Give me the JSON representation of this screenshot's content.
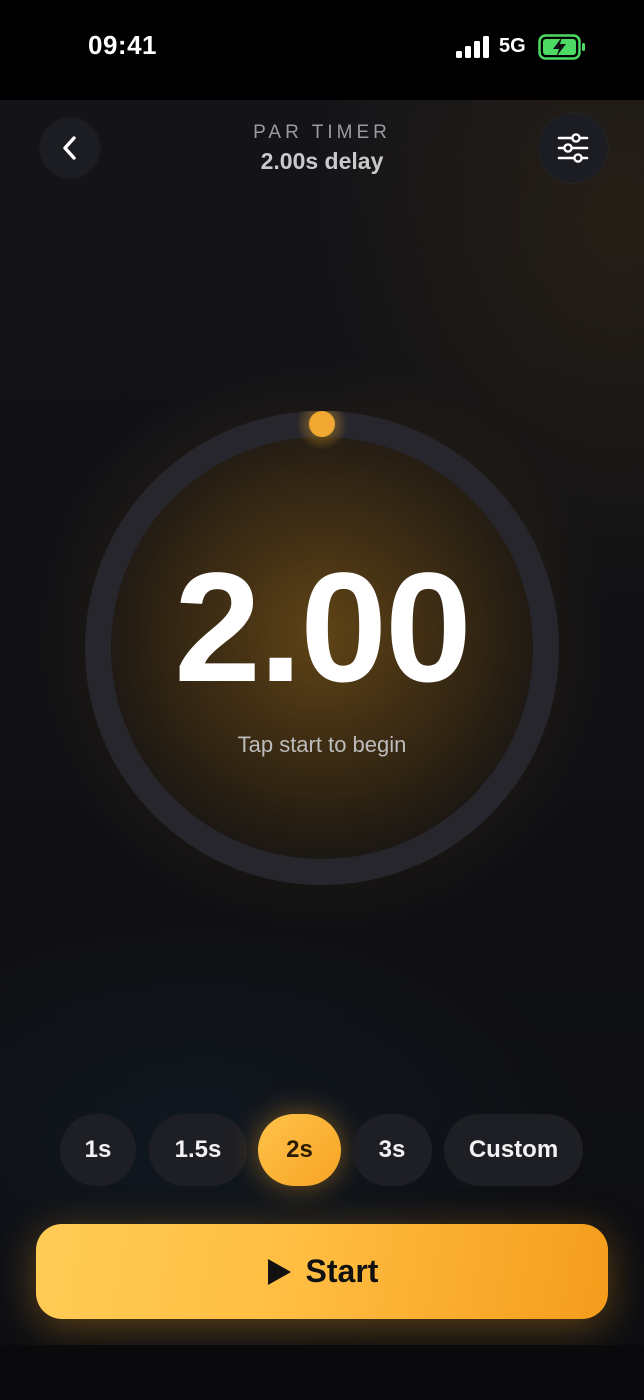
{
  "status_bar": {
    "time": "09:41",
    "network": "5G",
    "icons": [
      "signal-icon",
      "battery-charging-icon"
    ]
  },
  "header": {
    "title": "PAR TIMER",
    "subtitle": "2.00s delay",
    "back_icon": "chevron-left-icon",
    "settings_icon": "sliders-icon"
  },
  "timer": {
    "value": "2.00",
    "hint": "Tap start to begin",
    "progress": 0
  },
  "presets": {
    "items": [
      {
        "label": "1s",
        "active": false
      },
      {
        "label": "1.5s",
        "active": false
      },
      {
        "label": "2s",
        "active": true
      },
      {
        "label": "3s",
        "active": false
      },
      {
        "label": "Custom",
        "active": false
      }
    ]
  },
  "start_button": {
    "label": "Start",
    "icon": "play-icon"
  },
  "colors": {
    "accent": "#f7a424",
    "accent_light": "#ffc24a",
    "background": "#111114",
    "button_dark": "#1e1f24"
  }
}
